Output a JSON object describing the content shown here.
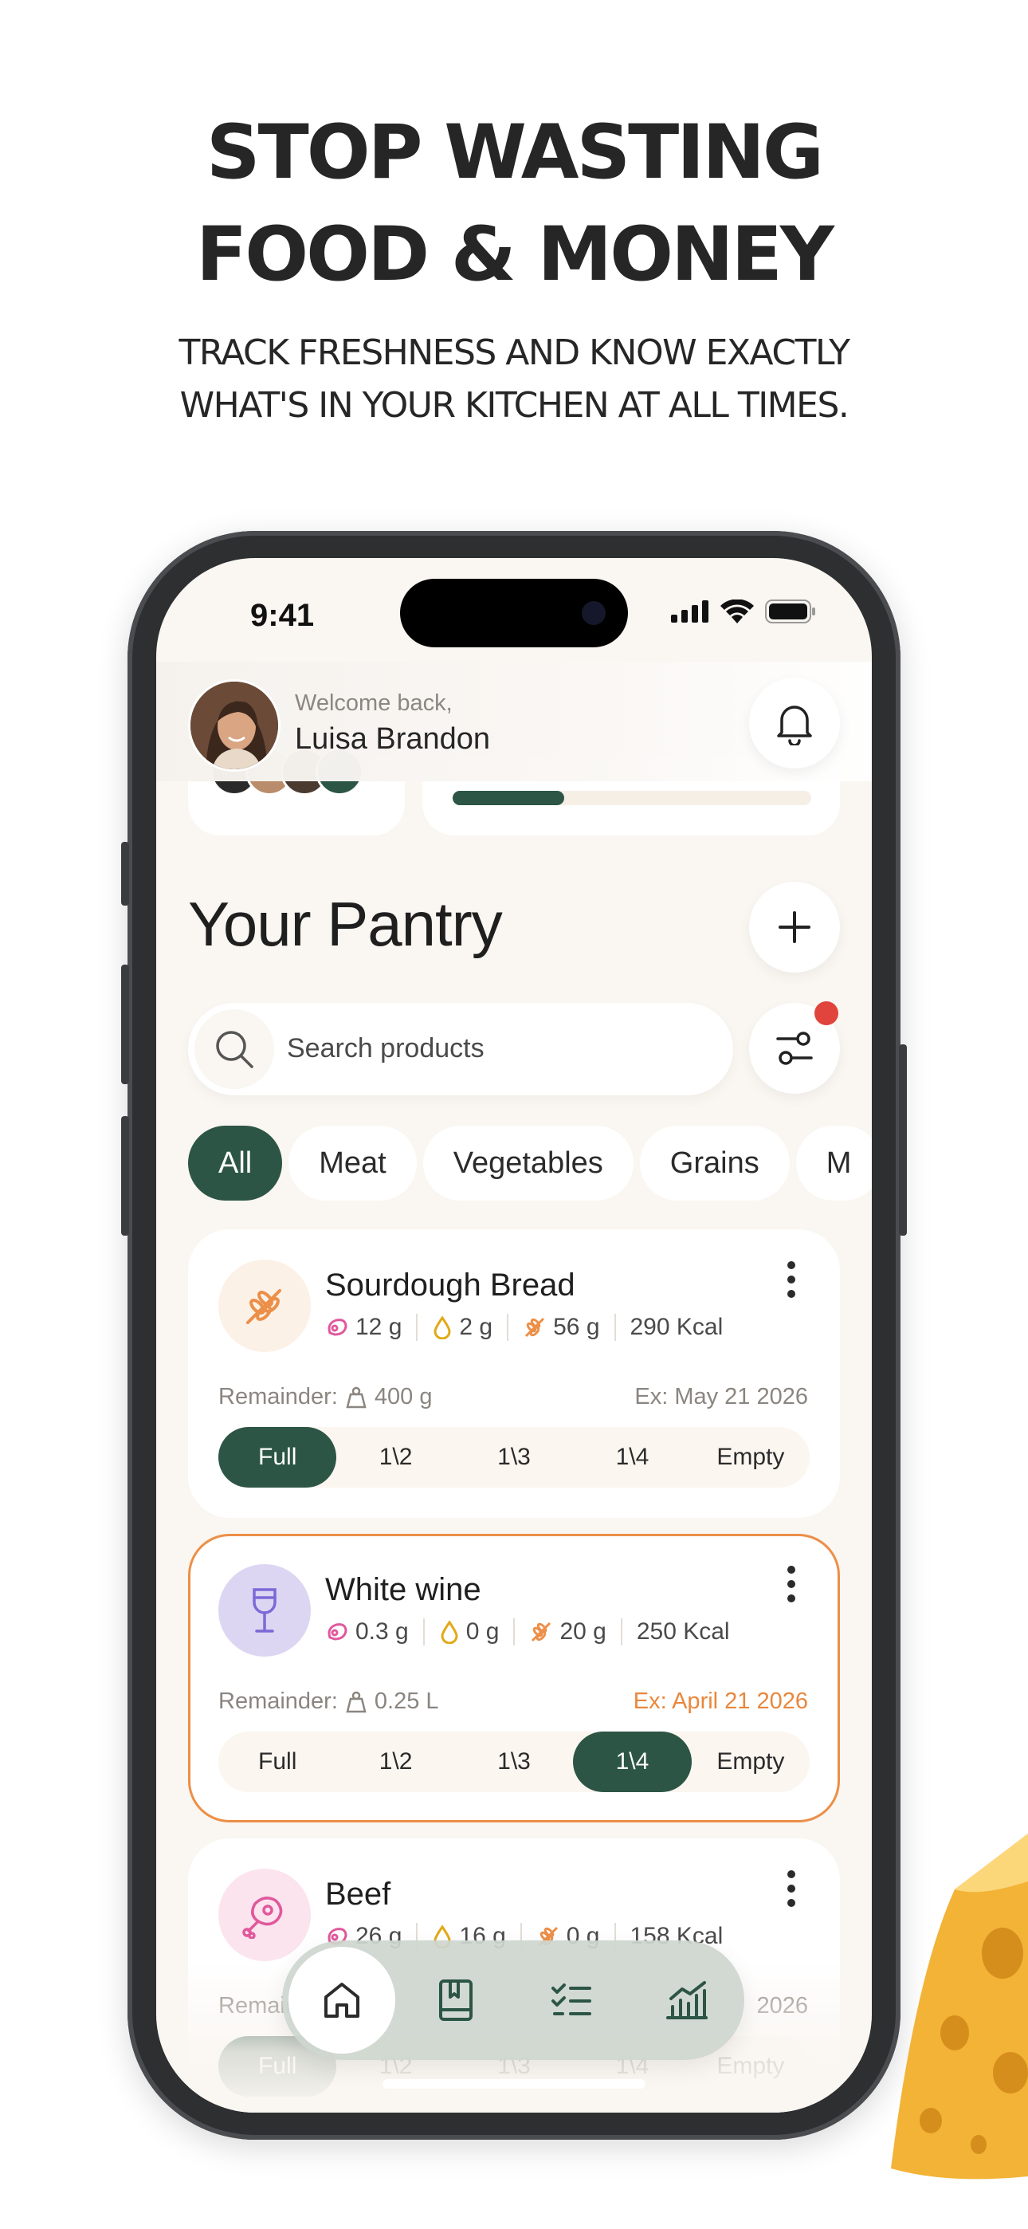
{
  "marketing": {
    "headline_line1": "STOP WASTING",
    "headline_line2": "FOOD & MONEY",
    "subline_line1": "TRACK FRESHNESS AND KNOW EXACTLY",
    "subline_line2": "WHAT'S IN YOUR KITCHEN AT ALL TIMES."
  },
  "status_bar": {
    "time": "9:41"
  },
  "header": {
    "welcome": "Welcome back,",
    "user_name": "Luisa Brandon"
  },
  "summary_progress": 0.31,
  "pantry": {
    "title": "Your Pantry",
    "search_placeholder": "Search products",
    "filter_has_notification": true,
    "categories": [
      "All",
      "Meat",
      "Vegetables",
      "Grains",
      "M"
    ],
    "active_category": "All",
    "level_options": [
      "Full",
      "1\\2",
      "1\\3",
      "1\\4",
      "Empty"
    ],
    "remainder_label": "Remainder:",
    "products": [
      {
        "name": "Sourdough Bread",
        "icon": "wheat-icon",
        "protein": "12 g",
        "fat": "2 g",
        "carbs": "56 g",
        "kcal": "290 Kcal",
        "remainder": "400 g",
        "expiry": "Ex: May 21 2026",
        "expiring_soon": false,
        "level": "Full"
      },
      {
        "name": "White wine",
        "icon": "wine-glass-icon",
        "protein": "0.3 g",
        "fat": "0 g",
        "carbs": "20 g",
        "kcal": "250 Kcal",
        "remainder": "0.25 L",
        "expiry": "Ex: April 21 2026",
        "expiring_soon": true,
        "level": "1\\4"
      },
      {
        "name": "Beef",
        "icon": "meat-icon",
        "protein": "26 g",
        "fat": "16 g",
        "carbs": "0 g",
        "kcal": "158 Kcal",
        "remainder": "",
        "expiry": "2026",
        "expiring_soon": false,
        "level": "Full"
      }
    ]
  },
  "tab_bar": {
    "items": [
      "home-icon",
      "recipe-book-icon",
      "checklist-icon",
      "analytics-icon"
    ],
    "active": "home-icon"
  },
  "colors": {
    "accent_green": "#2c5545",
    "warning_orange": "#ec8f48",
    "notification_red": "#e0443c",
    "background_cream": "#faf6f1"
  }
}
